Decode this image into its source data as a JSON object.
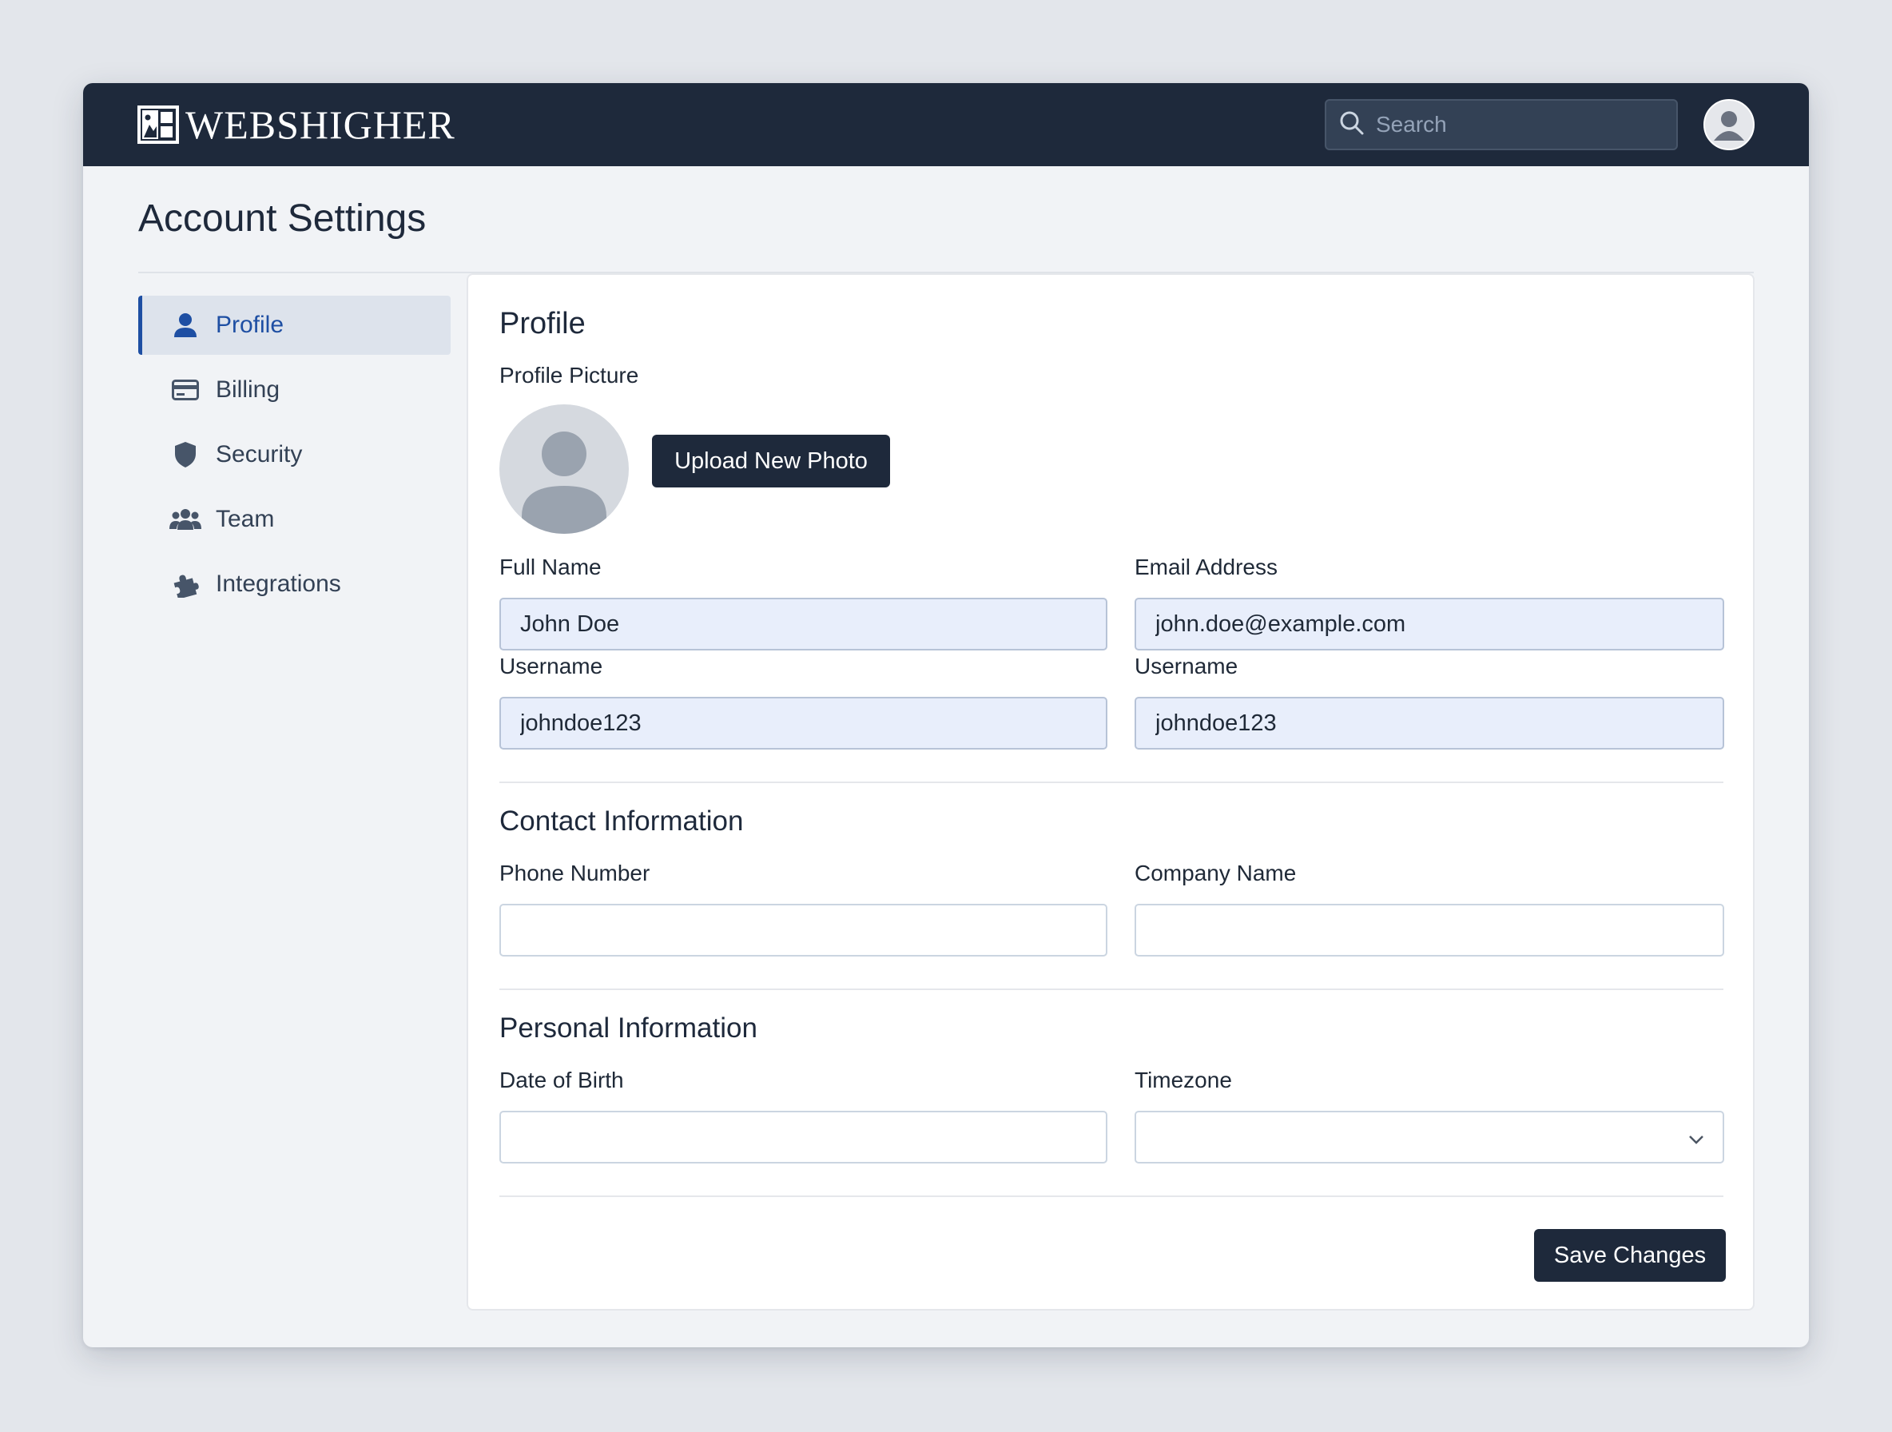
{
  "header": {
    "brand": "WEBSHIGHER",
    "search_placeholder": "Search"
  },
  "page": {
    "title": "Account Settings"
  },
  "sidebar": {
    "items": [
      {
        "label": "Profile",
        "icon": "user-icon",
        "active": true
      },
      {
        "label": "Billing",
        "icon": "credit-card-icon",
        "active": false
      },
      {
        "label": "Security",
        "icon": "shield-icon",
        "active": false
      },
      {
        "label": "Team",
        "icon": "team-icon",
        "active": false
      },
      {
        "label": "Integrations",
        "icon": "puzzle-icon",
        "active": false
      }
    ]
  },
  "profile": {
    "title": "Profile",
    "picture_label": "Profile Picture",
    "upload_label": "Upload New Photo",
    "full_name_label": "Full Name",
    "full_name_value": "John Doe",
    "email_label": "Email Address",
    "email_value": "john.doe@example.com",
    "username_label": "Username",
    "username_value": "johndoe123",
    "username2_label": "Username",
    "username2_value": "johndoe123"
  },
  "contact": {
    "title": "Contact Information",
    "phone_label": "Phone Number",
    "phone_value": "",
    "company_label": "Company Name",
    "company_value": ""
  },
  "personal": {
    "title": "Personal Information",
    "dob_label": "Date of Birth",
    "dob_value": "",
    "timezone_label": "Timezone",
    "timezone_value": ""
  },
  "actions": {
    "save_label": "Save Changes"
  },
  "colors": {
    "topbar": "#1e293b",
    "accent": "#1e4fa3",
    "filled_field": "#e8eefb"
  }
}
